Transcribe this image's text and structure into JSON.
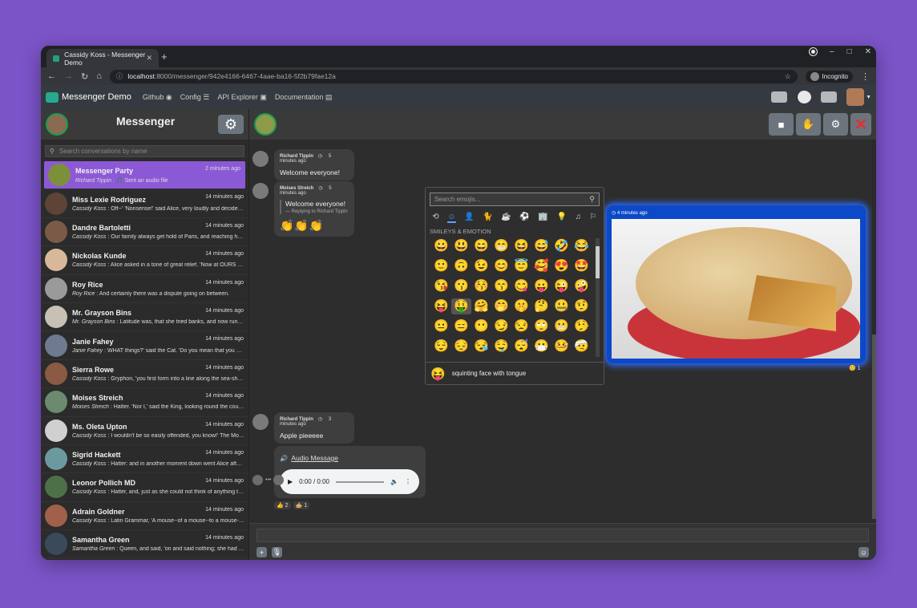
{
  "browser": {
    "tab_title": "Cassidy Koss - Messenger Demo",
    "new_tab": "+",
    "url_host": "localhost",
    "url_path": ":8000/messenger/942e4166-6467-4aae-ba16-5f2b79fae12a",
    "incognito": "Incognito",
    "window_controls": [
      "–",
      "□",
      "✕"
    ]
  },
  "navbar": {
    "brand": "Messenger Demo",
    "links": [
      "Github",
      "Config",
      "API Explorer",
      "Documentation"
    ]
  },
  "sidebar": {
    "title": "Messenger",
    "search_placeholder": "Search conversations by name",
    "conversations": [
      {
        "name": "Messenger Party",
        "time": "2 minutes ago",
        "sender": "Richard Tippin",
        "preview": " : 🎵 Sent an audio file",
        "color": "#7d8f3b"
      },
      {
        "name": "Miss Lexie Rodriguez",
        "time": "14 minutes ago",
        "sender": "Cassidy Koss",
        "preview": " : Off--' 'Nonsense!' said Alice, very loudly and decidedly...",
        "color": "#5d4436"
      },
      {
        "name": "Dandre Bartoletti",
        "time": "14 minutes ago",
        "sender": "Cassidy Koss",
        "preview": " : Our family always get hold of Paris, and reaching half ...",
        "color": "#7a5b48"
      },
      {
        "name": "Nickolas Kunde",
        "time": "14 minutes ago",
        "sender": "Cassidy Koss",
        "preview": " : Alice asked in a tone of great relief. 'Now at OURS the...",
        "color": "#d8b89a"
      },
      {
        "name": "Roy Rice",
        "time": "14 minutes ago",
        "sender": "Roy Rice",
        "preview": " : And certainly there was a dispute going on between.",
        "color": "#9a9a9a"
      },
      {
        "name": "Mr. Grayson Bins",
        "time": "14 minutes ago",
        "sender": "Mr. Grayson Bins",
        "preview": " : Latitude was, that she tried banks, and now run ba...",
        "color": "#c9c0b5"
      },
      {
        "name": "Janie Fahey",
        "time": "14 minutes ago",
        "sender": "Janie Fahey",
        "preview": " : WHAT things?' said the Cat. 'Do you mean that you we...",
        "color": "#6e7a90"
      },
      {
        "name": "Sierra Rowe",
        "time": "14 minutes ago",
        "sender": "Cassidy Koss",
        "preview": " : Gryphon, 'you first form into a line along the sea-shor...",
        "color": "#8a5a44"
      },
      {
        "name": "Moises Streich",
        "time": "14 minutes ago",
        "sender": "Moises Streich",
        "preview": " : Hatter. 'Nor I,' said the King, looking round the court ...",
        "color": "#6b8a70"
      },
      {
        "name": "Ms. Oleta Upton",
        "time": "14 minutes ago",
        "sender": "Cassidy Koss",
        "preview": " : I wouldn't be so easily offended, you know!' The Mous...",
        "color": "#d0d0d0"
      },
      {
        "name": "Sigrid Hackett",
        "time": "14 minutes ago",
        "sender": "Cassidy Koss",
        "preview": " : Hatter: and in another moment down went Alice after...",
        "color": "#6a9aa0"
      },
      {
        "name": "Leonor Pollich MD",
        "time": "14 minutes ago",
        "sender": "Cassidy Koss",
        "preview": " : Hatter, and, just as she could not think of anything to ...",
        "color": "#4d7048"
      },
      {
        "name": "Adrain Goldner",
        "time": "14 minutes ago",
        "sender": "Cassidy Koss",
        "preview": " : Latin Grammar, 'A mouse--of a mouse--to a mouse--a ...",
        "color": "#a0604a"
      },
      {
        "name": "Samantha Green",
        "time": "14 minutes ago",
        "sender": "Samantha Green",
        "preview": " : Queen, and said, 'on and said nothing; she had put ...",
        "color": "#3b4a5a"
      }
    ]
  },
  "chat": {
    "messages": {
      "m1": {
        "sender": "Richard Tippin",
        "time": "5 minutes ago",
        "text": "Welcome everyone!"
      },
      "m2": {
        "sender": "Moises Streich",
        "time": "5 minutes ago",
        "quote_text": "Welcome everyone!",
        "quote_reply": "— Replying to Richard Tippin",
        "text": "👏👏👏"
      },
      "m3": {
        "sender": "Richard Tippin",
        "time": "3 minutes ago",
        "text": "Apple pieeeee",
        "audio_label": "Audio Message",
        "audio_time": "0:00 / 0:00"
      },
      "image": {
        "time": "4 minutes ago",
        "reaction": "😊 1"
      }
    },
    "reactions": [
      "👍 2",
      "🥧 1"
    ]
  },
  "emoji_picker": {
    "search_placeholder": "Search emojis...",
    "categories": [
      "⟲",
      "☺",
      "👤",
      "🐈",
      "☕",
      "⚽",
      "🏢",
      "💡",
      "♫",
      "⚐"
    ],
    "section": "Smileys & Emotion",
    "emojis": [
      "😀",
      "😃",
      "😄",
      "😁",
      "😆",
      "😅",
      "🤣",
      "😂",
      "🙂",
      "🙃",
      "😉",
      "😊",
      "😇",
      "🥰",
      "😍",
      "🤩",
      "😘",
      "😗",
      "😚",
      "😙",
      "😋",
      "😛",
      "😜",
      "🤪",
      "😝",
      "🤑",
      "🤗",
      "🤭",
      "🤫",
      "🤔",
      "🤐",
      "🤨",
      "😐",
      "😑",
      "😶",
      "😏",
      "😒",
      "🙄",
      "😬",
      "🤥",
      "😌",
      "😔",
      "😪",
      "🤤",
      "😴",
      "😷",
      "🤒",
      "🤕"
    ],
    "selected_index": 25,
    "preview_emoji": "😝",
    "preview_name": "squinting face with tongue"
  },
  "colors": {
    "accent": "#8c59d6",
    "image_border": "#0b49c8",
    "danger": "#e03131"
  }
}
